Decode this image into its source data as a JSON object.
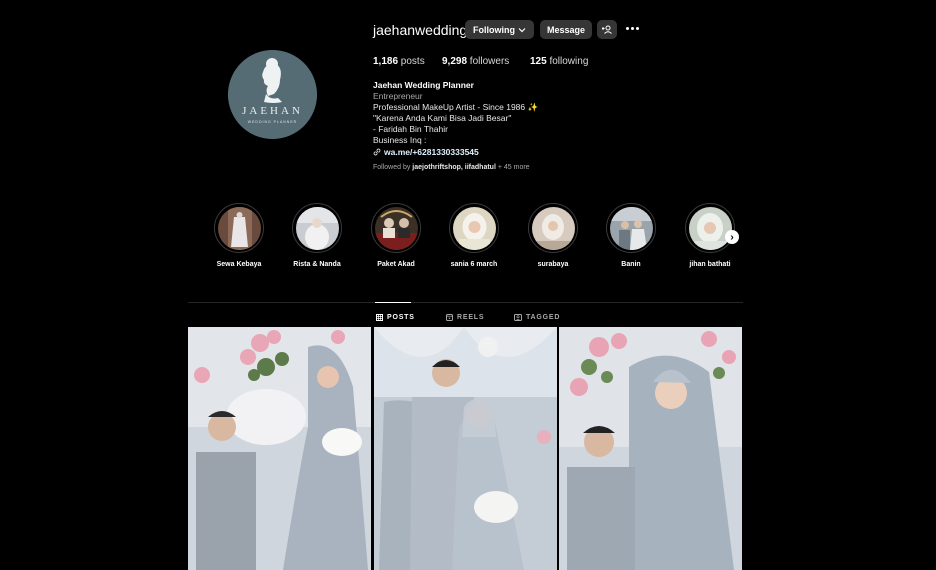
{
  "profile": {
    "username": "jaehanwedding",
    "following_label": "Following",
    "message_label": "Message",
    "avatar": {
      "brand": "JAEHAN",
      "tagline": "WEDDING PLANNER"
    }
  },
  "stats": {
    "posts": "1,186",
    "posts_label": " posts",
    "followers": "9,298",
    "followers_label": " followers",
    "following": "125",
    "following_label": " following"
  },
  "bio": {
    "name": "Jaehan Wedding Planner",
    "category": "Entrepreneur",
    "line1": "Professional MakeUp Artist - Since 1986 ✨",
    "line2": "\"Karena Anda Kami Bisa Jadi Besar\"",
    "line3": "- Faridah Bin Thahir",
    "line4": "Business Inq :",
    "link": "wa.me/+6281330333545"
  },
  "followed_by": {
    "prefix": "Followed by ",
    "names": "jaejothriftshop, iifadhatul",
    "suffix": " + 45 more"
  },
  "highlights": [
    {
      "label": "Sewa Kebaya"
    },
    {
      "label": "Rista & Nanda"
    },
    {
      "label": "Paket Akad"
    },
    {
      "label": "sania 6 march"
    },
    {
      "label": "surabaya"
    },
    {
      "label": "Banin"
    },
    {
      "label": "jihan bathati"
    }
  ],
  "tabs": [
    {
      "label": "POSTS",
      "icon": "grid-icon",
      "active": true
    },
    {
      "label": "REELS",
      "icon": "reels-icon",
      "active": false
    },
    {
      "label": "TAGGED",
      "icon": "tag-icon",
      "active": false
    }
  ],
  "posts": [
    {
      "alt": "wedding couple seated"
    },
    {
      "alt": "wedding couple standing"
    },
    {
      "alt": "wedding couple portrait"
    }
  ],
  "colors": {
    "background": "#000000",
    "button": "#363636",
    "link": "#e0f1ff",
    "muted": "#a8a8a8"
  }
}
